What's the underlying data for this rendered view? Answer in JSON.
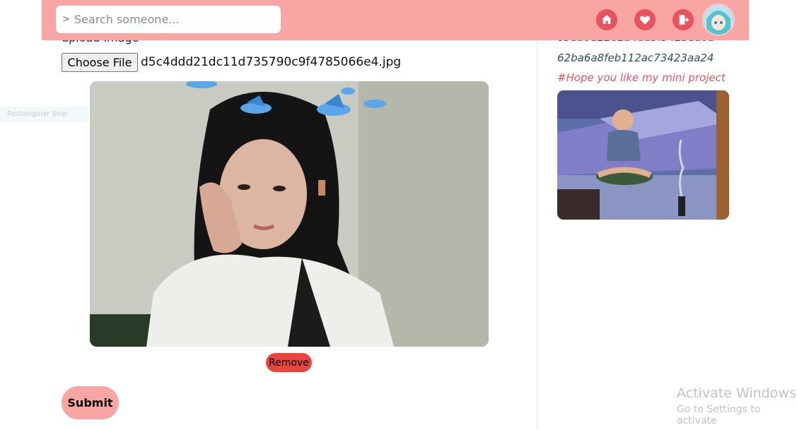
{
  "header": {
    "search": {
      "placeholder": "Search someone...",
      "value": ""
    },
    "icons": [
      "home-icon",
      "heart-icon",
      "logout-icon"
    ],
    "accent_color": "#f9a5a3",
    "icon_color": "#e8535e"
  },
  "form": {
    "file_button_label": "Choose File",
    "file_name": "d5c4ddd21dc11d735790c9f4785066e4.jpg",
    "remove_label": "Remove",
    "submit_label": "Submit"
  },
  "overlay": {
    "snip_label": "Rectangular Snip"
  },
  "sidebar_post": {
    "post_id": "62ba6a8feb112ac73423aa24",
    "caption": "#Hope you like my mini project"
  },
  "watermark": {
    "title": "Activate Windows",
    "subtitle": "Go to Settings to activate"
  }
}
